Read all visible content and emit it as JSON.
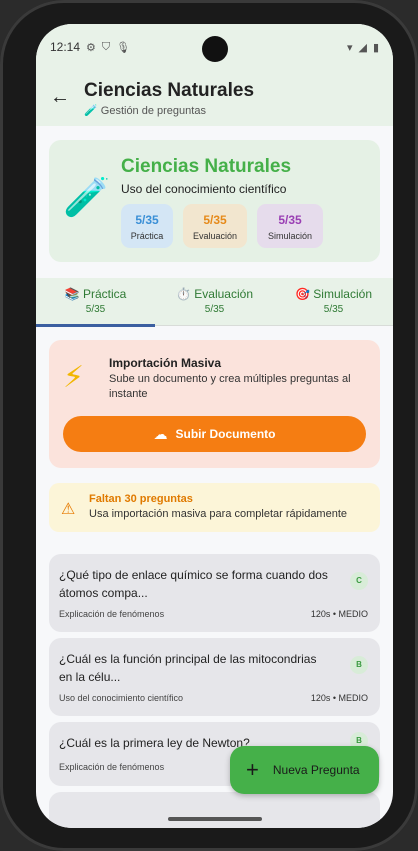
{
  "status": {
    "time": "12:14"
  },
  "header": {
    "title": "Ciencias Naturales",
    "subtitle_icon": "🧪",
    "subtitle": "Gestión de preguntas"
  },
  "subject": {
    "icon": "🧪",
    "title": "Ciencias Naturales",
    "description": "Uso del conocimiento científico",
    "chips": [
      {
        "value": "5/35",
        "label": "Práctica",
        "color": "#3a8fd6"
      },
      {
        "value": "5/35",
        "label": "Evaluación",
        "color": "#e68a1a"
      },
      {
        "value": "5/35",
        "label": "Simulación",
        "color": "#9a3fb4"
      }
    ]
  },
  "tabs": [
    {
      "icon": "📚",
      "label": "Práctica",
      "count": "5/35",
      "active": true
    },
    {
      "icon": "⏱️",
      "label": "Evaluación",
      "count": "5/35",
      "active": false
    },
    {
      "icon": "🎯",
      "label": "Simulación",
      "count": "5/35",
      "active": false
    }
  ],
  "import": {
    "icon": "⚡",
    "title": "Importación Masiva",
    "description": "Sube un documento y crea múltiples preguntas al instante",
    "button": "Subir Documento"
  },
  "warning": {
    "title": "Faltan 30 preguntas",
    "description": "Usa importación masiva para completar rápidamente"
  },
  "questions": [
    {
      "text": "¿Qué tipo de enlace químico se forma cuando dos átomos compa...",
      "badge": "C",
      "category": "Explicación de fenómenos",
      "meta": "120s • MEDIO"
    },
    {
      "text": "¿Cuál es la función principal de las mitocondrias en la célu...",
      "badge": "B",
      "category": "Uso del conocimiento científico",
      "meta": "120s • MEDIO"
    },
    {
      "text": "¿Cuál es la primera ley de Newton?",
      "badge": "B",
      "category": "Explicación de fenómenos",
      "meta": ""
    }
  ],
  "fab": {
    "label": "Nueva Pregunta"
  },
  "colors": {
    "accent": "#45b049",
    "upload": "#f57d12",
    "tab_indicator": "#3b5fa0"
  }
}
